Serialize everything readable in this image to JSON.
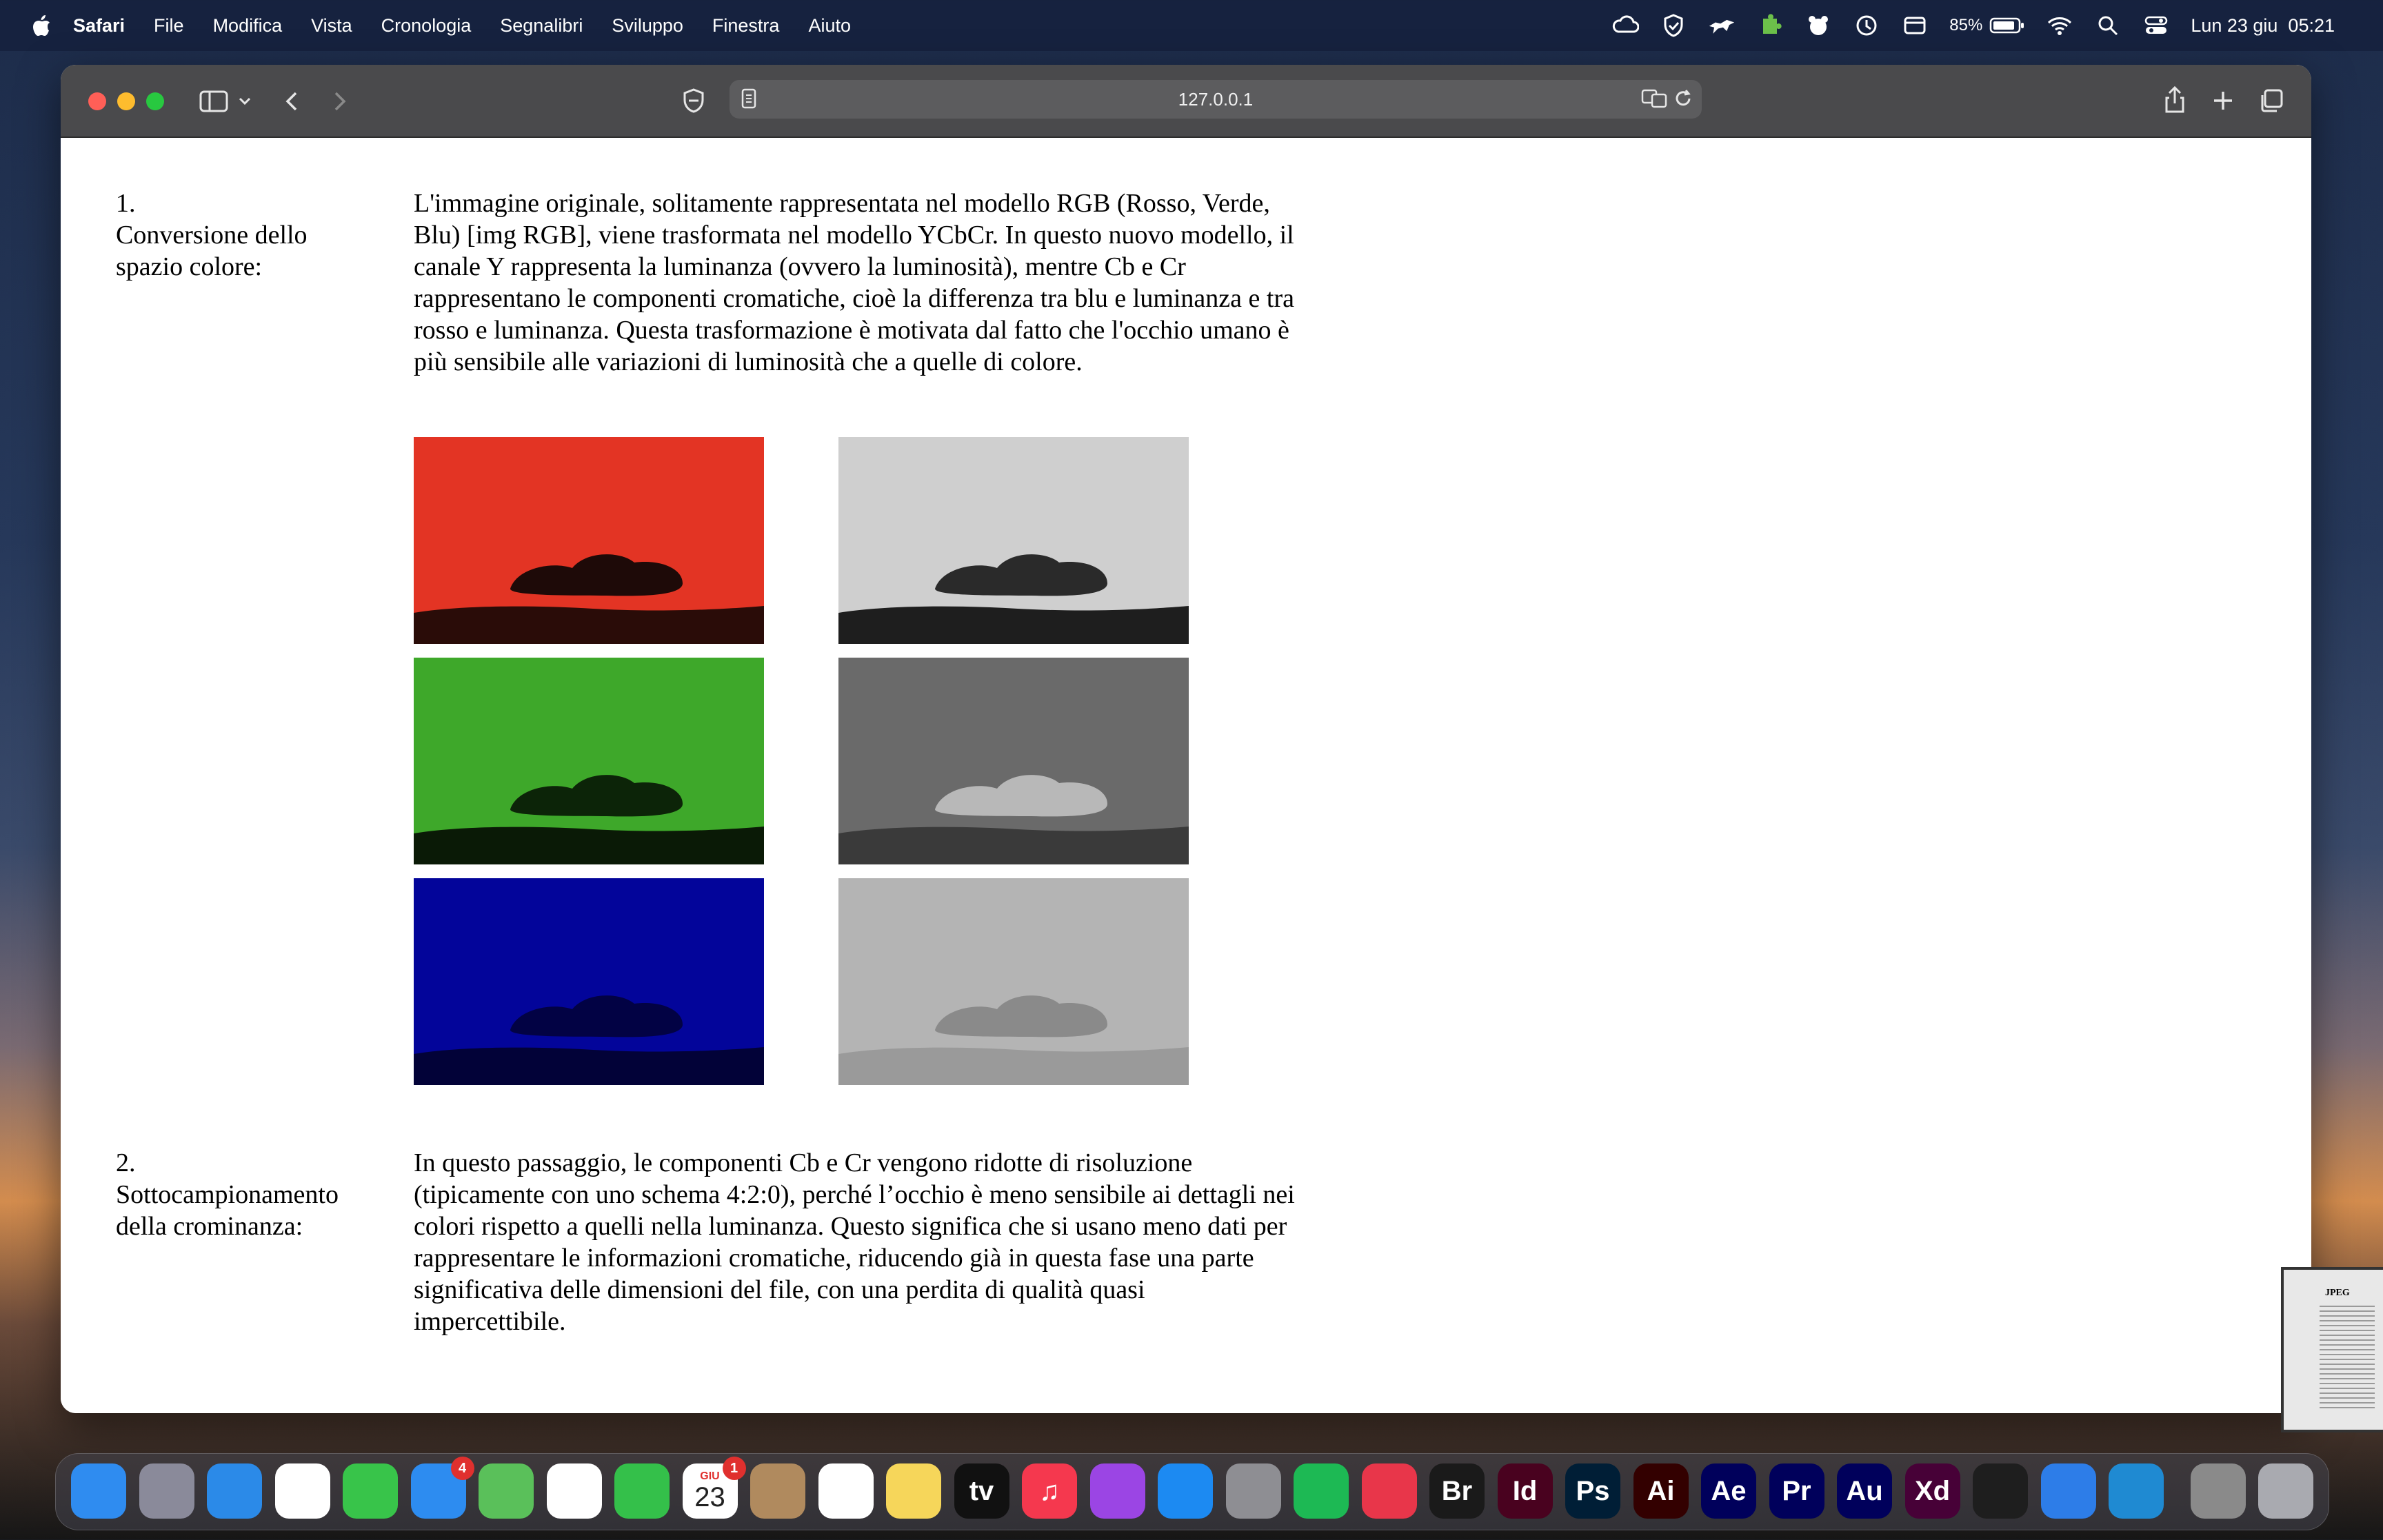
{
  "menubar": {
    "app": "Safari",
    "items": [
      "File",
      "Modifica",
      "Vista",
      "Cronologia",
      "Segnalibri",
      "Sviluppo",
      "Finestra",
      "Aiuto"
    ],
    "battery": "85%",
    "datetime": "Lun 23 giu  05:21"
  },
  "browser": {
    "url": "127.0.0.1"
  },
  "article": {
    "sections": [
      {
        "number": "1.",
        "title": "Conversione dello spazio colore:",
        "text": "L'immagine originale, solitamente rappresentata nel modello RGB (Rosso, Verde, Blu) [img RGB], viene trasformata nel modello YCbCr. In questo nuovo modello, il canale Y rappresenta la luminanza (ovvero la luminosità), mentre Cb e Cr rappresentano le componenti cromatiche, cioè la differenza tra blu e luminanza e tra rosso e luminanza. Questa trasformazione è motivata dal fatto che l'occhio umano è più sensibile alle variazioni di luminosità che a quelle di colore."
      },
      {
        "number": "2.",
        "title": "Sottocampionamento della crominanza:",
        "text": "In questo passaggio, le componenti Cb e Cr vengono ridotte di risoluzione (tipicamente con uno schema 4:2:0), perché l’occhio è meno sensibile ai dettagli nei colori rispetto a quelli nella luminanza. Questo significa che si usano meno dati per rappresentare le informazioni cromatiche, riducendo già in questa fase una parte significativa delle dimensioni del file, con una perdita di qualità quasi impercettibile."
      }
    ],
    "images": [
      {
        "name": "red-channel-image",
        "sky": "#e33424",
        "cloud": "#1e0a08",
        "ground": "#2a0c08"
      },
      {
        "name": "gray-image-1",
        "sky": "#cfcfcf",
        "cloud": "#2a2a2a",
        "ground": "#1e1e1e"
      },
      {
        "name": "green-channel-image",
        "sky": "#3ea82a",
        "cloud": "#0c2408",
        "ground": "#0a1a06"
      },
      {
        "name": "gray-image-2",
        "sky": "#6a6a6a",
        "cloud": "#b8b8b8",
        "ground": "#3a3a3a"
      },
      {
        "name": "blue-channel-image",
        "sky": "#03059a",
        "cloud": "#020244",
        "ground": "#020238"
      },
      {
        "name": "gray-image-3",
        "sky": "#b4b4b4",
        "cloud": "#8a8a8a",
        "ground": "#9a9a9a"
      }
    ]
  },
  "dock": {
    "apps": [
      {
        "name": "finder",
        "color": "#2f8cf0",
        "label": ""
      },
      {
        "name": "launchpad",
        "color": "#8a8a9a",
        "label": ""
      },
      {
        "name": "safari",
        "color": "#2b8ae8",
        "label": ""
      },
      {
        "name": "chrome",
        "color": "#ffffff",
        "label": ""
      },
      {
        "name": "messages",
        "color": "#38c44a",
        "label": ""
      },
      {
        "name": "mail",
        "color": "#2d8cf0",
        "label": "",
        "badge": "4"
      },
      {
        "name": "maps",
        "color": "#5ac05a",
        "label": ""
      },
      {
        "name": "photos",
        "color": "#ffffff",
        "label": ""
      },
      {
        "name": "facetime",
        "color": "#34c04a",
        "label": ""
      },
      {
        "name": "calendar",
        "color": "#ffffff",
        "label": "23",
        "badge": "1",
        "month": "GIU"
      },
      {
        "name": "contacts",
        "color": "#b08a5e",
        "label": ""
      },
      {
        "name": "reminders",
        "color": "#ffffff",
        "label": ""
      },
      {
        "name": "notes",
        "color": "#f6d65a",
        "label": ""
      },
      {
        "name": "tv",
        "color": "#111111",
        "label": "tv"
      },
      {
        "name": "music",
        "color": "#f5384e",
        "label": "♫"
      },
      {
        "name": "podcasts",
        "color": "#9b45e4",
        "label": ""
      },
      {
        "name": "app-store",
        "color": "#1c8af2",
        "label": ""
      },
      {
        "name": "system-settings",
        "color": "#8e8e93",
        "label": ""
      },
      {
        "name": "spotify",
        "color": "#1db954",
        "label": ""
      },
      {
        "name": "creative-cloud",
        "color": "#e8364a",
        "label": ""
      },
      {
        "name": "bridge",
        "color": "#1a1a1a",
        "label": "Br"
      },
      {
        "name": "indesign",
        "color": "#49021f",
        "label": "Id"
      },
      {
        "name": "photoshop",
        "color": "#001e36",
        "label": "Ps"
      },
      {
        "name": "illustrator",
        "color": "#330000",
        "label": "Ai"
      },
      {
        "name": "after-effects",
        "color": "#00005b",
        "label": "Ae"
      },
      {
        "name": "premiere",
        "color": "#00005b",
        "label": "Pr"
      },
      {
        "name": "audition",
        "color": "#00005b",
        "label": "Au"
      },
      {
        "name": "xd",
        "color": "#470137",
        "label": "Xd"
      },
      {
        "name": "figma",
        "color": "#1e1e1e",
        "label": ""
      },
      {
        "name": "diagram-app",
        "color": "#2d7de8",
        "label": ""
      },
      {
        "name": "vscode",
        "color": "#1f8ad2",
        "label": ""
      },
      {
        "name": "downloads-stack",
        "color": "#8a8a8a",
        "label": ""
      },
      {
        "name": "trash",
        "color": "#a9aab0",
        "label": ""
      }
    ]
  },
  "thumbnail": {
    "title": "JPEG"
  }
}
